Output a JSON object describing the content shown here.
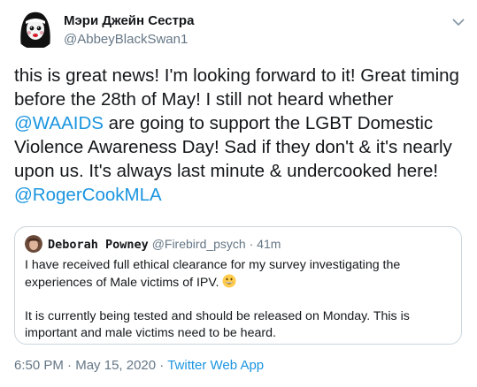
{
  "author": {
    "display_name": "Мэри Джейн Сестра",
    "handle": "@AbbeyBlackSwan1"
  },
  "tweet": {
    "text_part1": "this is great news! I'm looking forward to it! Great timing before the 28th of May! I still not heard whether ",
    "mention1": "@WAAIDS",
    "text_part2": "  are going to support the LGBT Domestic Violence Awareness Day! Sad if they don't & it's nearly upon us. It's always last minute & undercooked here! ",
    "mention2": "@RogerCookMLA"
  },
  "quoted_tweet": {
    "display_name": "Deborah Powney",
    "handle": "@Firebird_psych",
    "separator": "·",
    "time_ago": "41m",
    "paragraph1": "I have received full ethical clearance for my survey investigating the experiences of Male victims of IPV.",
    "paragraph2": "It is currently being tested and should be released on Monday.  This is important and male victims need to be heard.",
    "emoji_icon": "grinning-face-emoji"
  },
  "meta": {
    "time": "6:50 PM",
    "separator1": "·",
    "date": "May 15, 2020",
    "separator2": "·",
    "source": "Twitter Web App"
  },
  "colors": {
    "link": "#1b95e0",
    "secondary_text": "#657786",
    "primary_text": "#14171a",
    "border": "#ccd6dd"
  },
  "icons": {
    "caret": "chevron-down-icon"
  }
}
